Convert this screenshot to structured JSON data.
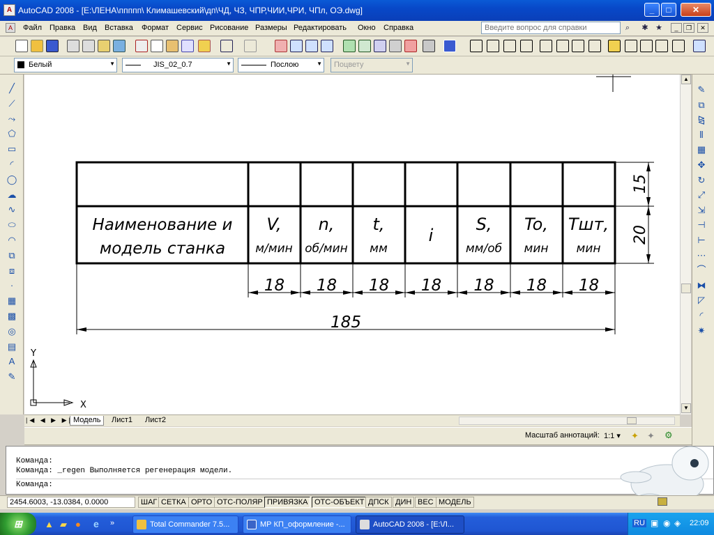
{
  "window": {
    "title": "AutoCAD 2008 - [E:\\ЛЕНА\\ппппп\\ Климашевский\\дп\\ЧД, ЧЗ, ЧПР,ЧИИ,ЧРИ, ЧПл, ОЭ.dwg]",
    "app_icon": "A",
    "minimize": "_",
    "maximize": "□",
    "close": "✕"
  },
  "menu": {
    "items": [
      "Файл",
      "Правка",
      "Вид",
      "Вставка",
      "Формат",
      "Сервис",
      "Рисование",
      "Размеры",
      "Редактировать",
      "Окно",
      "Справка"
    ],
    "help_placeholder": "Введите вопрос для справки"
  },
  "properties": {
    "color": "Белый",
    "linetype": "JIS_02_0.7",
    "lineweight": "Послою",
    "plotstyle": "Поцвету"
  },
  "drawing": {
    "header_name": [
      "Наименование и",
      "модель станка"
    ],
    "columns": [
      {
        "symbol": "V,",
        "unit": "м/мин"
      },
      {
        "symbol": "n,",
        "unit": "об/мин"
      },
      {
        "symbol": "t,",
        "unit": "мм"
      },
      {
        "symbol": "i",
        "unit": ""
      },
      {
        "symbol": "S,",
        "unit": "мм/об"
      },
      {
        "symbol": "To,",
        "unit": "мин"
      },
      {
        "symbol": "Tшт,",
        "unit": "мин"
      }
    ],
    "col_dims": [
      "18",
      "18",
      "18",
      "18",
      "18",
      "18",
      "18"
    ],
    "total_dim": "185",
    "row_dims": [
      "15",
      "20"
    ],
    "ucs_x": "X",
    "ucs_y": "Y"
  },
  "tabs": [
    "Модель",
    "Лист1",
    "Лист2"
  ],
  "annotation": {
    "label": "Масштаб аннотаций:",
    "scale": "1:1"
  },
  "command_lines": [
    "Команда:",
    "Команда: _regen Выполняется регенерация модели.",
    "Команда:"
  ],
  "status": {
    "coords": "2454.6003, -13.0384, 0.0000",
    "buttons": [
      "ШАГ",
      "СЕТКА",
      "ОРТО",
      "ОТС-ПОЛЯР",
      "ПРИВЯЗКА",
      "ОТС-ОБЪЕКТ",
      "ДПСК",
      "ДИН",
      "ВЕС",
      "МОДЕЛЬ"
    ]
  },
  "taskbar": {
    "tasks": [
      "Total Commander 7.5...",
      "МР КП_оформление -...",
      "AutoCAD 2008 - [E:\\Л..."
    ],
    "lang": "RU",
    "time": "22:09"
  }
}
